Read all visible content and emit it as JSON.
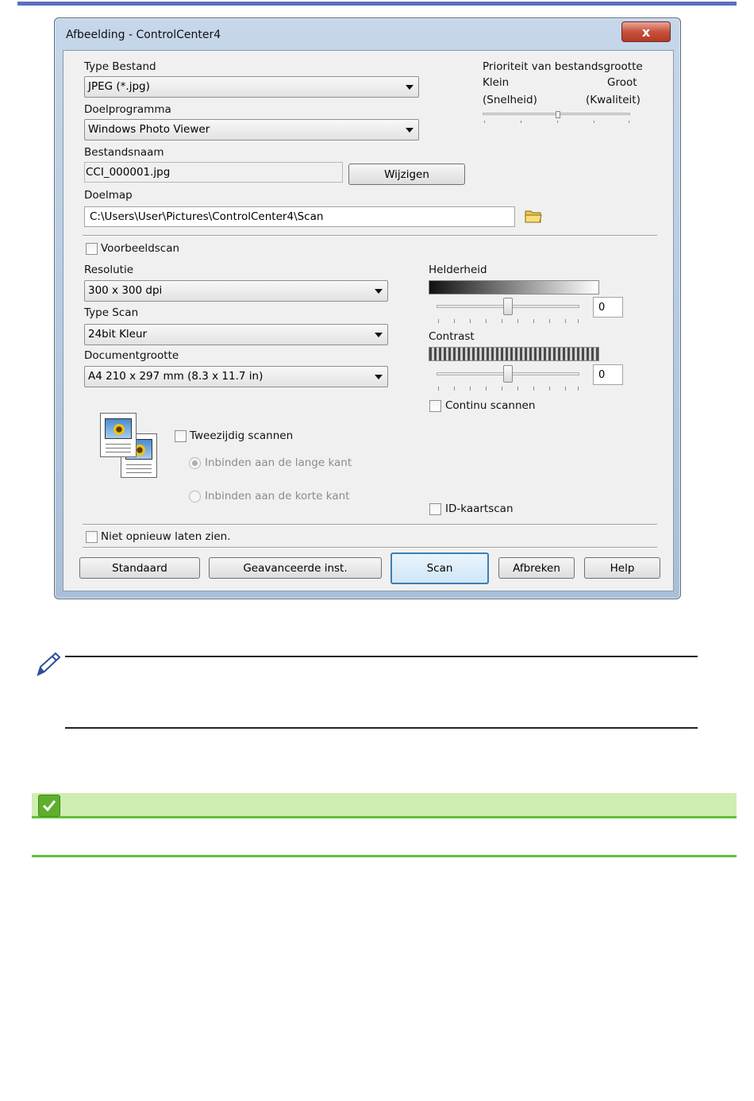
{
  "window": {
    "title": "Afbeelding - ControlCenter4",
    "close_glyph": "x"
  },
  "file_type": {
    "label": "Type Bestand",
    "value": "JPEG (*.jpg)"
  },
  "target_app": {
    "label": "Doelprogramma",
    "value": "Windows Photo Viewer"
  },
  "file_name": {
    "label": "Bestandsnaam",
    "value": "CCI_000001.jpg",
    "change_button": "Wijzigen"
  },
  "destination": {
    "label": "Doelmap",
    "value": "C:\\Users\\User\\Pictures\\ControlCenter4\\Scan",
    "folder_icon": "folder-icon"
  },
  "file_size_priority": {
    "label": "Prioriteit van bestandsgrootte",
    "left_label": "Klein",
    "right_label": "Groot",
    "left_sublabel": "(Snelheid)",
    "right_sublabel": "(Kwaliteit)",
    "level": 0.5
  },
  "preview_scan": {
    "label": "Voorbeeldscan",
    "checked": false
  },
  "resolution": {
    "label": "Resolutie",
    "value": "300 x 300 dpi"
  },
  "scan_type": {
    "label": "Type Scan",
    "value": "24bit Kleur"
  },
  "document_size": {
    "label": "Documentgrootte",
    "value": "A4 210 x 297 mm (8.3 x 11.7 in)"
  },
  "brightness": {
    "label": "Helderheid",
    "value": "0",
    "level": 0.5
  },
  "contrast": {
    "label": "Contrast",
    "value": "0",
    "level": 0.5
  },
  "continuous_scan": {
    "label": "Continu scannen",
    "checked": false
  },
  "duplex": {
    "label": "Tweezijdig scannen",
    "checked": false,
    "long_edge": "Inbinden aan de lange kant",
    "short_edge": "Inbinden aan de korte kant",
    "selected": "long_edge"
  },
  "id_card_scan": {
    "label": "ID-kaartscan",
    "checked": false
  },
  "dont_show_again": {
    "label": "Niet opnieuw laten zien.",
    "checked": false
  },
  "buttons": {
    "default": "Standaard",
    "advanced": "Geavanceerde inst.",
    "scan": "Scan",
    "cancel": "Afbreken",
    "help": "Help"
  },
  "colors": {
    "accent_bar": "#5b6fbf",
    "tip_bar": "#cfeeb2",
    "tip_border": "#5fc13a",
    "check_icon": "#5fae2e"
  },
  "icons": [
    "pencil-icon",
    "checkmark-icon",
    "folder-icon",
    "document-pages-icon"
  ]
}
